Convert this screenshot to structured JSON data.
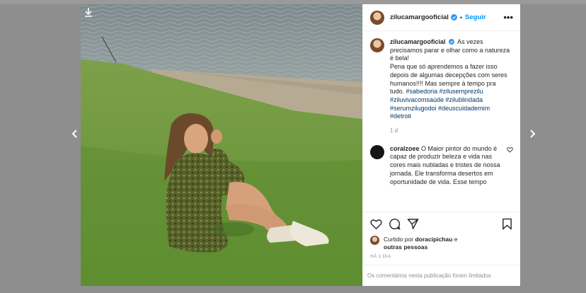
{
  "post": {
    "username": "zilucamargooficial",
    "follow_label": "Seguir",
    "dot": "•",
    "more_label": "•••",
    "caption_text": "As vezes precisamos parar e olhar como a natureza é bela!\nPena que só aprendemos a fazer isso depois de algumas decepções com seres humanos!!!! Mas sempre à tempo pra tudo.",
    "hashtags": "#sabedoria #zilusemprezilu #ziluvivacomsaúde #zilublindada #serumzilugodoi #deuscuidademim #detroit",
    "caption_time": "1 d"
  },
  "comment": {
    "username": "coralzoee",
    "text": "O Maior pintor do mundo é capaz de produzir beleza e vida nas cores mais nubladas e tristes de nossa jornada. Ele transforma desertos em oportunidade de vida. Esse tempo"
  },
  "likes": {
    "prefix": "Curtido por",
    "user": "doracipichau",
    "connector": "e",
    "others": "outras pessoas"
  },
  "time_ago": "HÁ 1 DIA",
  "comments_limited": "Os comentários nesta publicação foram limitados",
  "icons": {
    "download": "download-icon",
    "prev": "chevron-left-icon",
    "next": "chevron-right-icon",
    "verified": "verified-badge-icon",
    "like": "heart-icon",
    "comment": "comment-icon",
    "share": "share-icon",
    "save": "bookmark-icon"
  },
  "colors": {
    "accent": "#0095f6",
    "hashtag": "#00376b",
    "muted": "#8e8e8e",
    "text": "#262626"
  }
}
